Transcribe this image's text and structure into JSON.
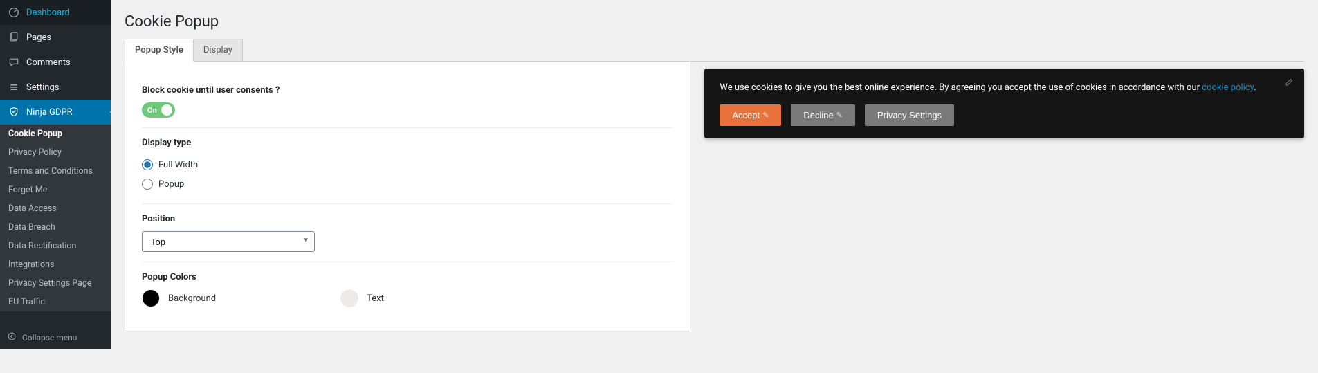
{
  "sidebar": {
    "items": [
      {
        "icon": "dashboard",
        "label": "Dashboard"
      },
      {
        "icon": "pages",
        "label": "Pages"
      },
      {
        "icon": "comments",
        "label": "Comments"
      },
      {
        "icon": "settings",
        "label": "Settings"
      },
      {
        "icon": "shield",
        "label": "Ninja GDPR",
        "active": true
      }
    ],
    "submenu": [
      "Cookie Popup",
      "Privacy Policy",
      "Terms and Conditions",
      "Forget Me",
      "Data Access",
      "Data Breach",
      "Data Rectification",
      "Integrations",
      "Privacy Settings Page",
      "EU Traffic"
    ],
    "collapse": "Collapse menu"
  },
  "page": {
    "title": "Cookie Popup"
  },
  "tabs": [
    {
      "label": "Popup Style",
      "active": true
    },
    {
      "label": "Display",
      "active": false
    }
  ],
  "fields": {
    "block_label": "Block cookie until user consents ?",
    "toggle_state": "On",
    "display_type_label": "Display type",
    "display_options": [
      {
        "label": "Full Width",
        "checked": true
      },
      {
        "label": "Popup",
        "checked": false
      }
    ],
    "position_label": "Position",
    "position_value": "Top",
    "popup_colors_label": "Popup Colors",
    "colors": [
      {
        "name": "Background",
        "hex": "#000000"
      },
      {
        "name": "Text",
        "hex": "#efe9e9"
      }
    ]
  },
  "cookie_bar": {
    "text_before": "We use cookies to give you the best online experience. By agreeing you accept the use of cookies in accordance with our ",
    "link_text": "cookie policy",
    "text_after": ".",
    "accept": "Accept",
    "decline": "Decline",
    "privacy": "Privacy Settings",
    "accent_color": "#e8713c"
  }
}
